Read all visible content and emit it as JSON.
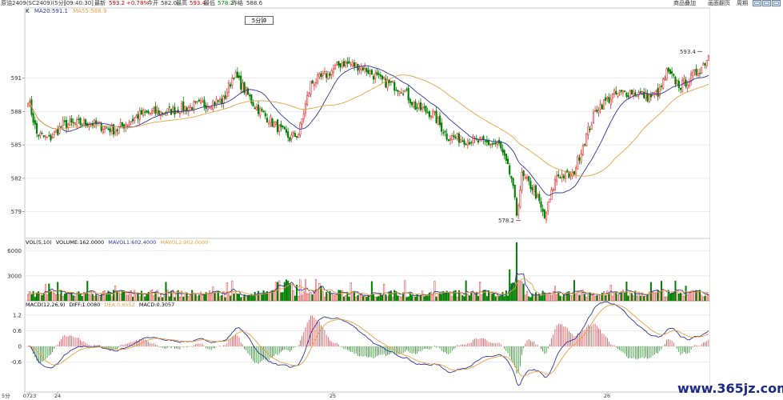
{
  "header": {
    "symbol": "原油2409(SC2409)(5分)",
    "time": "[09:40:30]",
    "latest_label": "最新",
    "latest": "593.2",
    "change": "+0.78%",
    "open_label": "今开",
    "open": "582.0",
    "high_label": "最高",
    "high": "593.4",
    "low_label": "最低",
    "low": "578.2",
    "prev_label": "昨结",
    "prev": "588.6",
    "links": [
      "商品叠加",
      "画面翻页",
      "周期"
    ]
  },
  "price_panel": {
    "k_label": "K",
    "ma20_label": "MA20:591.1",
    "ma55_label": "MA55:588.9",
    "period_badge": "5分钟",
    "y_ticks": [
      "591",
      "588",
      "585",
      "582",
      "579"
    ],
    "high_annotation": "593.4",
    "low_annotation": "578.2",
    "colors": {
      "up": "#e03030",
      "down": "#008000",
      "ma20": "#333399",
      "ma55": "#e8a040"
    }
  },
  "volume_panel": {
    "label": "VOL(5,10)",
    "volume_label": "VOLUME:162.0000",
    "mavol1_label": "MAVOL1:602.4000",
    "mavol2_label": "MAVOL2:902.0000",
    "y_ticks": [
      "6000",
      "3000"
    ]
  },
  "macd_panel": {
    "label": "MACD(12,26,9)",
    "diff_label": "DIFF:1.0080",
    "dea_label": "DEA:0.8552",
    "macd_label": "MACD:0.3057",
    "y_ticks": [
      "1.2",
      "0.6",
      "0",
      "-0.6"
    ]
  },
  "x_axis": {
    "period": "5分",
    "ticks": [
      "0723",
      "24",
      "25",
      "26"
    ]
  },
  "watermark": "www.365jz.com"
}
